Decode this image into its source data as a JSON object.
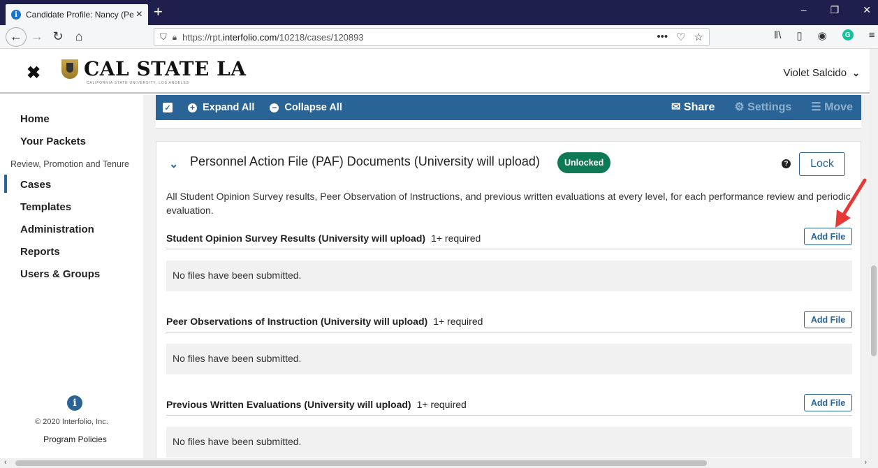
{
  "browser": {
    "tab_title": "Candidate Profile: Nancy (Perfo",
    "url_prefix": "https://rpt.",
    "url_domain": "interfolio.com",
    "url_path": "/10218/cases/120893"
  },
  "header": {
    "logo_text": "CAL STATE LA",
    "logo_subtext": "CALIFORNIA STATE UNIVERSITY, LOS ANGELES",
    "user_name": "Violet Salcido"
  },
  "sidebar": {
    "items": [
      {
        "label": "Home"
      },
      {
        "label": "Your Packets"
      },
      {
        "label": "Cases"
      },
      {
        "label": "Templates"
      },
      {
        "label": "Administration"
      },
      {
        "label": "Reports"
      },
      {
        "label": "Users & Groups"
      }
    ],
    "section_label": "Review, Promotion and Tenure",
    "copyright": "© 2020 Interfolio, Inc.",
    "policies": "Program Policies"
  },
  "toolbar": {
    "expand_all": "Expand All",
    "collapse_all": "Collapse All",
    "share": "Share",
    "settings": "Settings",
    "move": "Move"
  },
  "card": {
    "title": "Personnel Action File (PAF) Documents (University will upload)",
    "status_badge": "Unlocked",
    "lock_label": "Lock",
    "description": "All Student Opinion Survey results, Peer Observation of Instructions, and previous written evaluations at every level, for each performance review and periodic evaluation.",
    "sections": [
      {
        "title": "Student Opinion Survey Results (University will upload)",
        "requirement": "1+ required",
        "add_label": "Add File",
        "empty_text": "No files have been submitted."
      },
      {
        "title": "Peer Observations of Instruction (University will upload)",
        "requirement": "1+ required",
        "add_label": "Add File",
        "empty_text": "No files have been submitted."
      },
      {
        "title": "Previous Written Evaluations (University will upload)",
        "requirement": "1+ required",
        "add_label": "Add File",
        "empty_text": "No files have been submitted."
      }
    ]
  },
  "colors": {
    "primary": "#2a6496",
    "badge_green": "#0e7a55",
    "annotation_red": "#e53935"
  }
}
